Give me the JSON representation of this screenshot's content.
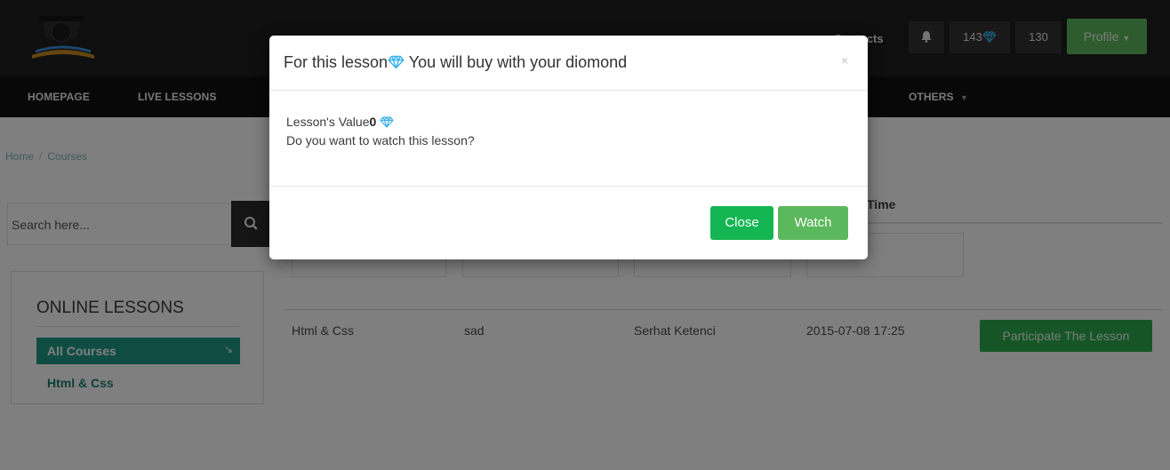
{
  "header": {
    "contacts_label": "Contacts",
    "diamonds_count": "143",
    "counter_value": "130",
    "profile_label": "Profile",
    "icons": [
      "graduation-cap-book-logo",
      "bell-icon",
      "diamond-icon",
      "caret-down-icon"
    ]
  },
  "nav": {
    "items": [
      {
        "label": "HOMEPAGE"
      },
      {
        "label": "LIVE LESSONS"
      },
      {
        "label": "OTHERS"
      }
    ]
  },
  "breadcrumb": {
    "home": "Home",
    "courses": "Courses"
  },
  "search": {
    "placeholder": "Search here..."
  },
  "online_lessons": {
    "title": "ONLINE LESSONS",
    "items": [
      {
        "label": "All Courses",
        "active": true
      },
      {
        "label": "Html & Css",
        "active": false
      }
    ]
  },
  "table": {
    "time_header": "Time",
    "row": {
      "course": "Html & Css",
      "title": "sad",
      "teacher": "Serhat Ketenci",
      "time": "2015-07-08 17:25",
      "action": "Participate The Lesson"
    }
  },
  "modal": {
    "title_before": "For this lesson",
    "title_after": " You will buy with your diomond",
    "close_x": "×",
    "value_label": "Lesson's Value",
    "value_amount": "0",
    "question": "Do you want to watch this lesson?",
    "close_button": "Close",
    "watch_button": "Watch"
  },
  "colors": {
    "dark_bar": "#1e1e1e",
    "nav_bar": "#101010",
    "accent_teal": "#1e9b86",
    "green_button": "#5cb85c",
    "bright_green": "#14b553",
    "diamond": "#3bb3ea"
  }
}
